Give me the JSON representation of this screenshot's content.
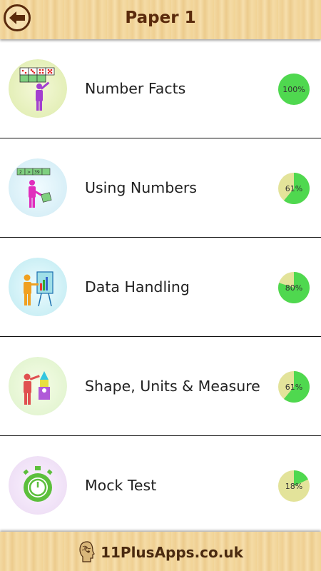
{
  "header": {
    "title": "Paper 1"
  },
  "rows": [
    {
      "label": "Number Facts",
      "progress": 100,
      "progress_label": "100%",
      "icon": "number-facts-icon"
    },
    {
      "label": "Using Numbers",
      "progress": 61,
      "progress_label": "61%",
      "icon": "using-numbers-icon"
    },
    {
      "label": "Data Handling",
      "progress": 80,
      "progress_label": "80%",
      "icon": "data-handling-icon"
    },
    {
      "label": "Shape, Units & Measure",
      "progress": 61,
      "progress_label": "61%",
      "icon": "shape-units-icon"
    },
    {
      "label": "Mock Test",
      "progress": 18,
      "progress_label": "18%",
      "icon": "stopwatch-icon"
    }
  ],
  "footer": {
    "brand": "11PlusApps.co.uk",
    "logo": "head-logo-icon"
  },
  "colors": {
    "header_text": "#5a2a0c",
    "pie_done": "#4fd84f",
    "pie_remaining": "#e3e39a",
    "wood_light": "#f6dfad",
    "wood_dark": "#eccb8c"
  }
}
